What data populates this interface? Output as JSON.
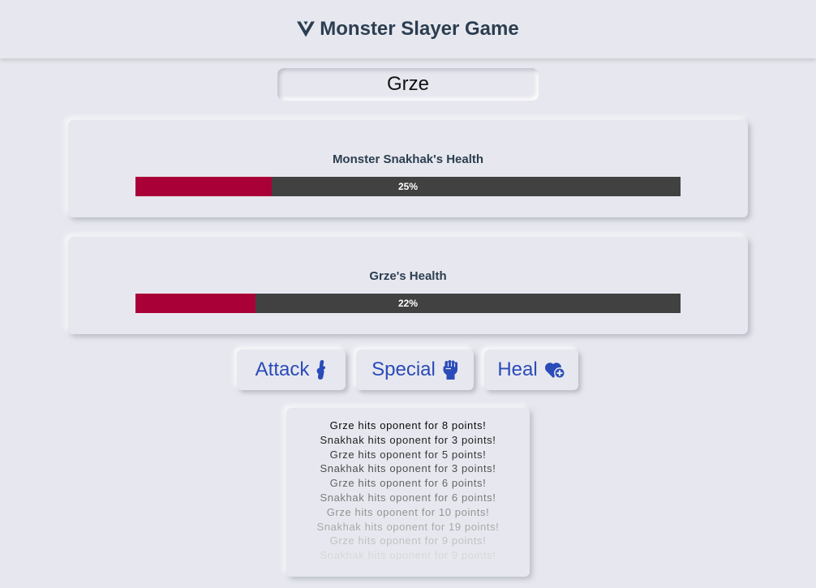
{
  "header": {
    "title": "Monster Slayer Game",
    "logo_icon": "vue-logo-icon"
  },
  "player_name": "Grze",
  "monster": {
    "label": "Monster Snakhak's Health",
    "health_percent": 25,
    "health_text": "25%"
  },
  "player": {
    "label": "Grze's Health",
    "health_percent": 22,
    "health_text": "22%"
  },
  "actions": {
    "attack": {
      "label": "Attack",
      "icon": "raised-fist-icon"
    },
    "special": {
      "label": "Special",
      "icon": "fist-icon"
    },
    "heal": {
      "label": "Heal",
      "icon": "heart-plus-icon"
    }
  },
  "log": [
    "Grze hits oponent for 8 points!",
    "Snakhak hits oponent for 3 points!",
    "Grze hits oponent for 5 points!",
    "Snakhak hits oponent for 3 points!",
    "Grze hits oponent for 6 points!",
    "Snakhak hits oponent for 6 points!",
    "Grze hits oponent for 10 points!",
    "Snakhak hits oponent for 19 points!",
    "Grze hits oponent for 9 points!",
    "Snakhak hits oponent for 9 points!"
  ],
  "colors": {
    "background": "#e7e8ef",
    "health_fill": "#aa0038",
    "health_track": "#414141",
    "accent": "#2a4bb8",
    "title": "#2c3e50"
  }
}
